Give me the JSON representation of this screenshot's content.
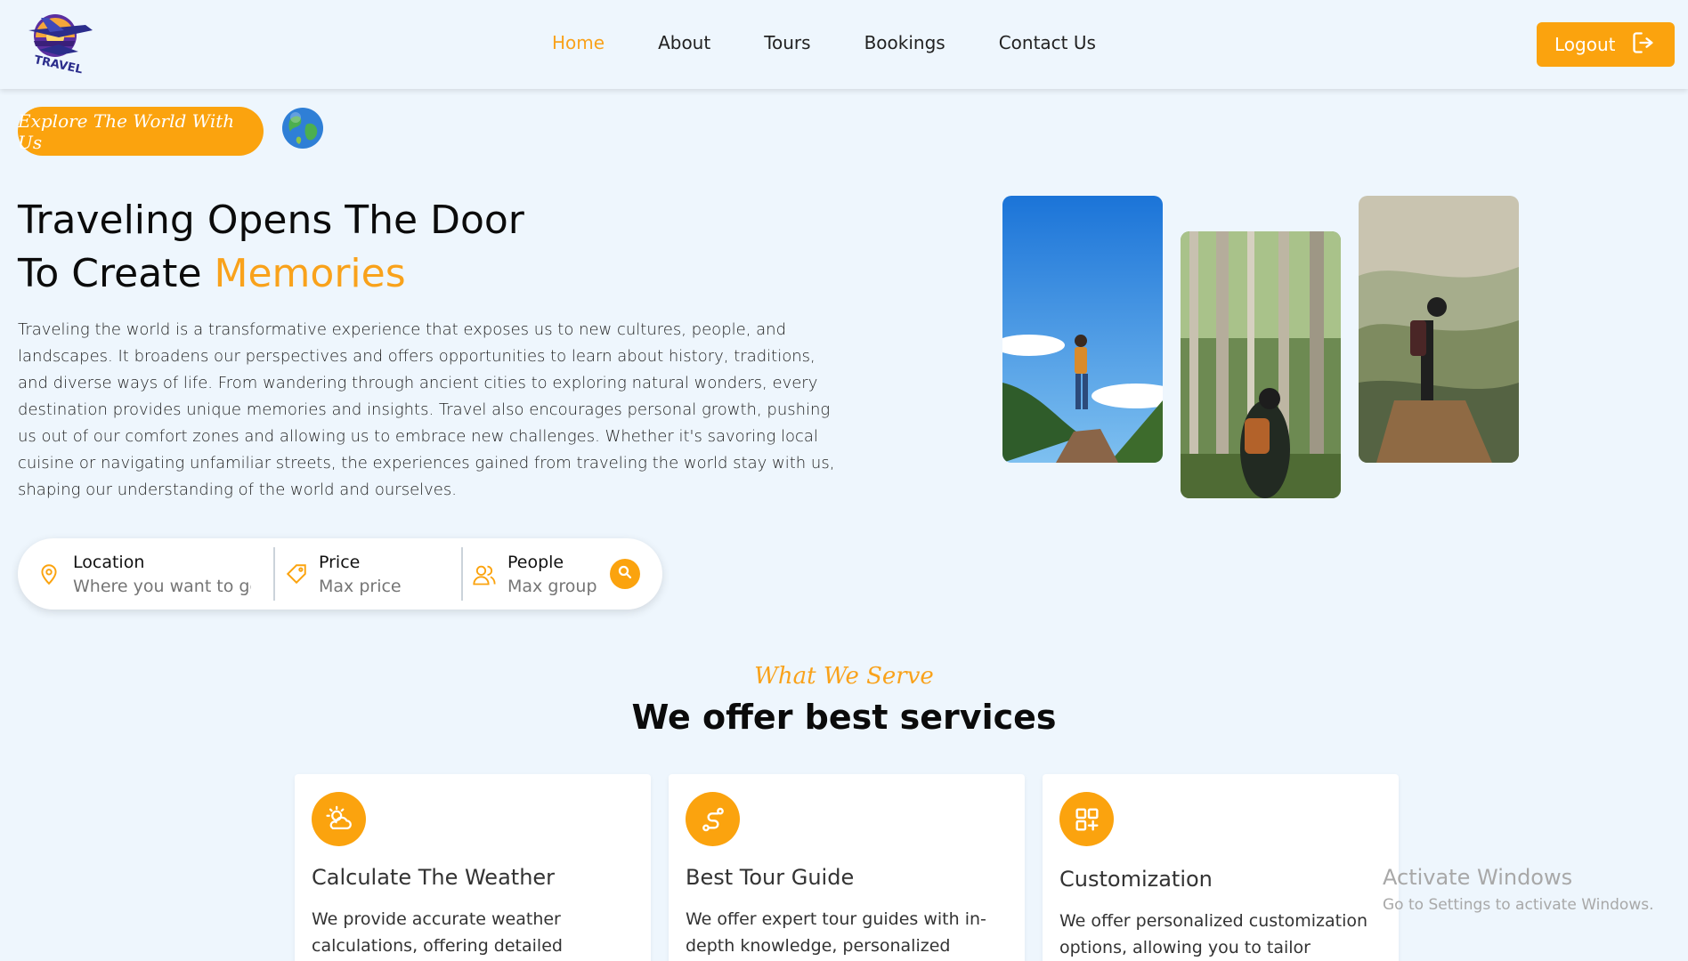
{
  "brand": {
    "logo_text": "TRAVEL"
  },
  "nav": {
    "items": [
      {
        "label": "Home",
        "active": true
      },
      {
        "label": "About",
        "active": false
      },
      {
        "label": "Tours",
        "active": false
      },
      {
        "label": "Bookings",
        "active": false
      },
      {
        "label": "Contact Us",
        "active": false
      }
    ],
    "logout_label": "Logout"
  },
  "hero": {
    "pill_label": "Explore The World With Us",
    "title_line1": "Traveling Opens The Door",
    "title_line2_prefix": "To Create ",
    "title_accent": "Memories",
    "paragraph": "Traveling the world is a transformative experience that exposes us to new cultures, people, and landscapes. It broadens our perspectives and offers opportunities to learn about history, traditions, and diverse ways of life. From wandering through ancient cities to exploring natural wonders, every destination provides unique memories and insights. Travel also encourages personal growth, pushing us out of our comfort zones and allowing us to embrace new challenges. Whether it's savoring local cuisine or navigating unfamiliar streets, the experiences gained from traveling the world stay with us, shaping our understanding of the world and ourselves."
  },
  "search": {
    "location_label": "Location",
    "location_placeholder": "Where you want to go?",
    "price_label": "Price",
    "price_placeholder": "Max price",
    "people_label": "People",
    "people_placeholder": "Max group"
  },
  "services": {
    "subtitle": "What We Serve",
    "title": "We offer best services",
    "cards": [
      {
        "title": "Calculate The Weather",
        "text": "We provide accurate weather calculations, offering detailed forecasts,",
        "icon": "weather-icon"
      },
      {
        "title": "Best Tour Guide",
        "text": "We offer expert tour guides with in-depth knowledge, personalized",
        "icon": "route-icon"
      },
      {
        "title": "Customization",
        "text": "We offer personalized customization options, allowing you to tailor products,",
        "icon": "grid-plus-icon"
      }
    ]
  },
  "watermark": {
    "line1": "Activate Windows",
    "line2": "Go to Settings to activate Windows."
  },
  "colors": {
    "accent": "#fba30e",
    "accent_text": "#f9a21b",
    "background": "#eef6fd"
  }
}
